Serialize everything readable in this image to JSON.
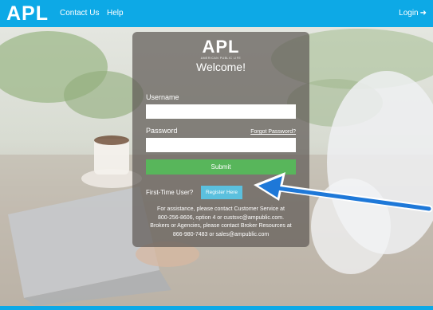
{
  "header": {
    "logo": "APL",
    "nav": [
      {
        "label": "Contact Us"
      },
      {
        "label": "Help"
      }
    ],
    "login_label": "Login",
    "login_icon": "sign-in-icon"
  },
  "login_panel": {
    "logo": "APL",
    "logo_subtitle": "AMERICAN PUBLIC LIFE",
    "welcome": "Welcome!",
    "username_label": "Username",
    "username_value": "",
    "password_label": "Password",
    "password_value": "",
    "forgot_password": "Forgot Password?",
    "submit_label": "Submit",
    "first_time_label": "First-Time User?",
    "register_label": "Register Here",
    "assistance_lines": [
      "For assistance, please contact Customer Service at",
      "800-256-8606, option 4 or custsvc@ampublic.com.",
      "Brokers or Agencies, please contact Broker Resources at",
      "866-980-7483 or sales@ampublic.com"
    ]
  },
  "colors": {
    "header_bg": "#0da9e6",
    "submit_bg": "#58b65b",
    "register_bg": "#5bc0de",
    "annotation_arrow": "#1e78d8"
  }
}
